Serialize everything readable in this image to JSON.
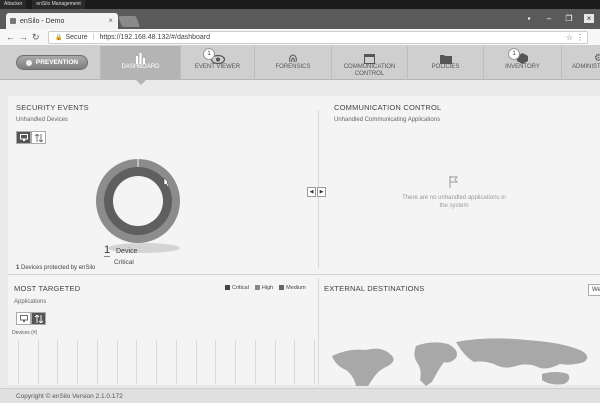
{
  "host_tabs": [
    "Attacker",
    "enSilo Management"
  ],
  "browser": {
    "tab_title": "enSilo - Demo",
    "secure_label": "Secure",
    "url": "https://192.168.48.132/#/dashboard"
  },
  "app": {
    "mode_label": "PREVENTION",
    "nav": [
      {
        "label": "DASHBOARD",
        "icon": "bar-chart-icon",
        "active": true
      },
      {
        "label": "EVENT VIEWER",
        "icon": "eye-icon",
        "badge": "1"
      },
      {
        "label": "FORENSICS",
        "icon": "fingerprint-icon"
      },
      {
        "label": "COMMUNICATION\nCONTROL",
        "icon": "window-icon"
      },
      {
        "label": "POLICIES",
        "icon": "folder-icon"
      },
      {
        "label": "INVENTORY",
        "icon": "box-icon",
        "badge": "1"
      },
      {
        "label": "ADMINIST",
        "icon": "gear-icon"
      }
    ]
  },
  "security_events": {
    "title": "SECURITY EVENTS",
    "subtitle": "Unhandled Devices",
    "count": "1",
    "count_label": "Device",
    "severity": "Critical",
    "protected_count": "1",
    "protected_text": "Devices protected by enSilo"
  },
  "communication_control": {
    "title": "COMMUNICATION CONTROL",
    "subtitle": "Unhandled Communicating Applications",
    "empty_message": "There are no unhandled applications in the system"
  },
  "most_targeted": {
    "title": "MOST TARGETED",
    "subtitle": "Applications",
    "devices_label": "Devices (#)",
    "legend": [
      {
        "label": "Critical",
        "color": "#444444"
      },
      {
        "label": "High",
        "color": "#888888"
      },
      {
        "label": "Medium",
        "color": "#666666"
      }
    ]
  },
  "external_destinations": {
    "title": "EXTERNAL DESTINATIONS",
    "control_label": "We"
  },
  "footer": {
    "copyright": "Copyright © enSilo Version 2.1.0.172"
  },
  "colors": {
    "nav_active": "#b4b4b4",
    "donut_outer": "#8c8c8c",
    "donut_inner": "#5f5f5f"
  }
}
